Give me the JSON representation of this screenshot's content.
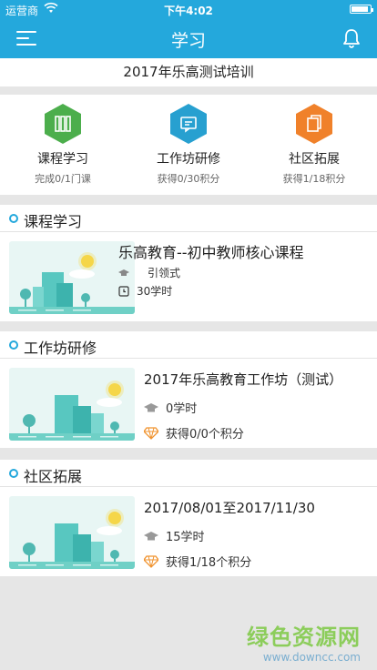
{
  "status_bar": {
    "carrier": "运营商",
    "time": "下午4:02",
    "battery_level": 0.9
  },
  "nav": {
    "title": "学习"
  },
  "banner": {
    "text": "2017年乐高测试培训"
  },
  "summary": [
    {
      "label": "课程学习",
      "sub": "完成0/1门课",
      "color": "#4cae4c",
      "icon": "books-icon"
    },
    {
      "label": "工作坊研修",
      "sub": "获得0/30积分",
      "color": "#27a0d0",
      "icon": "chat-monitor-icon"
    },
    {
      "label": "社区拓展",
      "sub": "获得1/18积分",
      "color": "#f0812a",
      "icon": "documents-icon"
    }
  ],
  "sections": {
    "course": {
      "title": "课程学习",
      "item": {
        "title": "乐高教育--初中教师核心课程",
        "type": "引领式",
        "hours": "30学时"
      }
    },
    "workshop": {
      "title": "工作坊研修",
      "item": {
        "title": "2017年乐高教育工作坊（测试）",
        "hours": "0学时",
        "points": "获得0/0个积分"
      }
    },
    "community": {
      "title": "社区拓展",
      "item": {
        "title": "2017/08/01至2017/11/30",
        "hours": "15学时",
        "points": "获得1/18个积分"
      }
    }
  },
  "watermark": {
    "line1": "绿色资源网",
    "line2": "www.downcc.com"
  }
}
